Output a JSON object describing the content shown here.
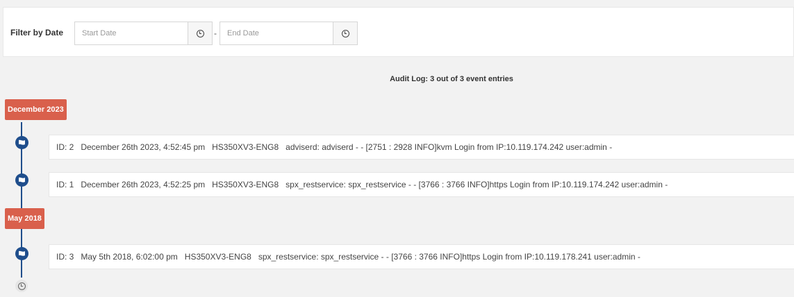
{
  "filter": {
    "label": "Filter by Date",
    "start_placeholder": "Start Date",
    "separator": "-",
    "end_placeholder": "End Date"
  },
  "audit_summary": "Audit Log: 3 out of 3 event entries",
  "colors": {
    "month_badge": "#d9604c",
    "timeline": "#1f4e8c",
    "background": "#f2f2f2"
  },
  "groups": [
    {
      "month": "December 2023",
      "entries": [
        {
          "id": "ID: 2",
          "datetime": "December 26th 2023, 4:52:45 pm",
          "host": "HS350XV3-ENG8",
          "message": "adviserd: adviserd - - [2751 : 2928 INFO]kvm Login from IP:10.119.174.242 user:admin -"
        },
        {
          "id": "ID: 1",
          "datetime": "December 26th 2023, 4:52:25 pm",
          "host": "HS350XV3-ENG8",
          "message": "spx_restservice: spx_restservice - - [3766 : 3766 INFO]https Login from IP:10.119.174.242 user:admin -"
        }
      ]
    },
    {
      "month": "May 2018",
      "entries": [
        {
          "id": "ID: 3",
          "datetime": "May 5th 2018, 6:02:00 pm",
          "host": "HS350XV3-ENG8",
          "message": "spx_restservice: spx_restservice - - [3766 : 3766 INFO]https Login from IP:10.119.178.241 user:admin -"
        }
      ]
    }
  ],
  "icons": {
    "entry_marker": "flag-icon",
    "timeline_end": "clock-icon",
    "date_picker": "clock-icon"
  }
}
